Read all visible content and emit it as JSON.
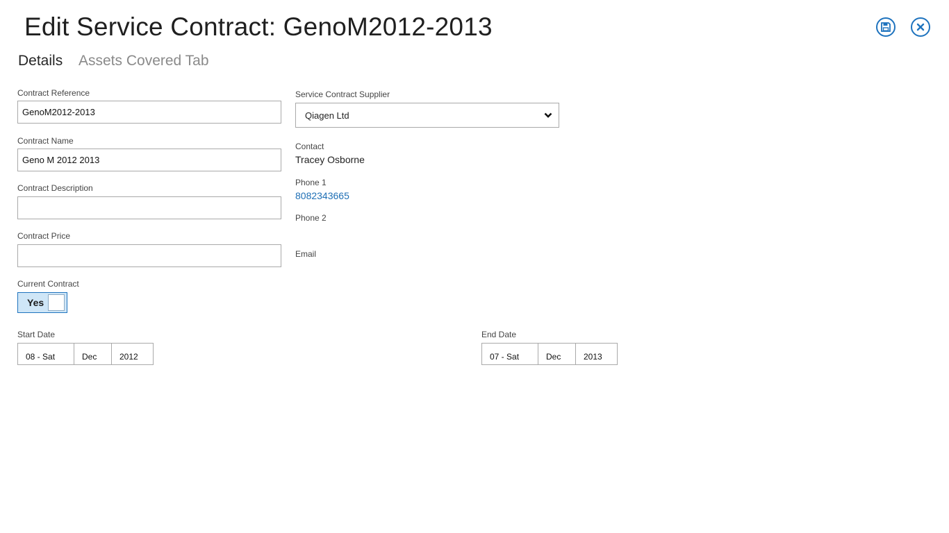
{
  "header": {
    "title": "Edit Service Contract: GenoM2012-2013",
    "save_icon": "save-icon",
    "close_icon": "close-icon",
    "accent_color": "#1e73be"
  },
  "tabs": [
    {
      "label": "Details",
      "active": true
    },
    {
      "label": "Assets Covered Tab",
      "active": false
    }
  ],
  "form": {
    "contract_reference": {
      "label": "Contract Reference",
      "value": "GenoM2012-2013"
    },
    "contract_name": {
      "label": "Contract Name",
      "value": "Geno M 2012 2013"
    },
    "contract_description": {
      "label": "Contract Description",
      "value": ""
    },
    "contract_price": {
      "label": "Contract Price",
      "value": ""
    },
    "current_contract": {
      "label": "Current Contract",
      "value": "Yes"
    },
    "supplier": {
      "label": "Service Contract Supplier",
      "value": "Qiagen Ltd"
    },
    "contact": {
      "label": "Contact",
      "value": "Tracey Osborne"
    },
    "phone1": {
      "label": "Phone 1",
      "value": "8082343665"
    },
    "phone2": {
      "label": "Phone 2",
      "value": ""
    },
    "email": {
      "label": "Email",
      "value": ""
    },
    "start_date": {
      "label": "Start Date",
      "day": "08 - Sat",
      "month": "Dec",
      "year": "2012"
    },
    "end_date": {
      "label": "End Date",
      "day": "07 - Sat",
      "month": "Dec",
      "year": "2013"
    }
  }
}
